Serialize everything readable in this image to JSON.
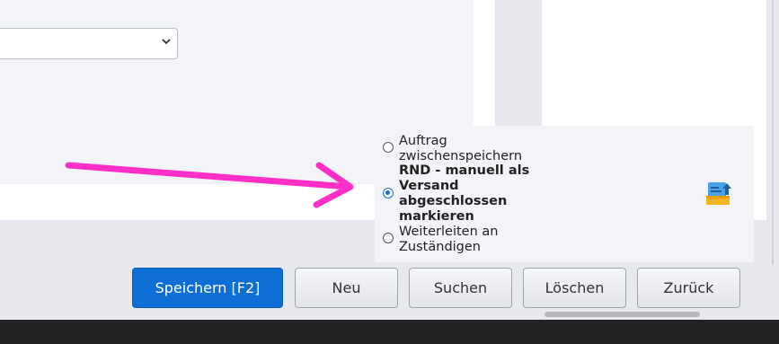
{
  "dropdown": {
    "value": "",
    "icon": "chevron-down-icon"
  },
  "radio_group": {
    "options": [
      {
        "label": "Auftrag zwischenspeichern",
        "checked": false
      },
      {
        "label": "RND - manuell als Versand abgeschlossen markieren",
        "checked": true
      },
      {
        "label": "Weiterleiten an Zuständigen",
        "checked": false
      }
    ]
  },
  "icons": {
    "tray": "tray-upload-icon",
    "annotation": "pink-arrow-annotation"
  },
  "buttons": {
    "save": "Speichern [F2]",
    "new": "Neu",
    "search": "Suchen",
    "delete": "Löschen",
    "back": "Zurück"
  },
  "colors": {
    "primary": "#0d6fd6",
    "annotation_arrow": "#ff2fc8",
    "radio_checked": "#1a6fd8"
  }
}
